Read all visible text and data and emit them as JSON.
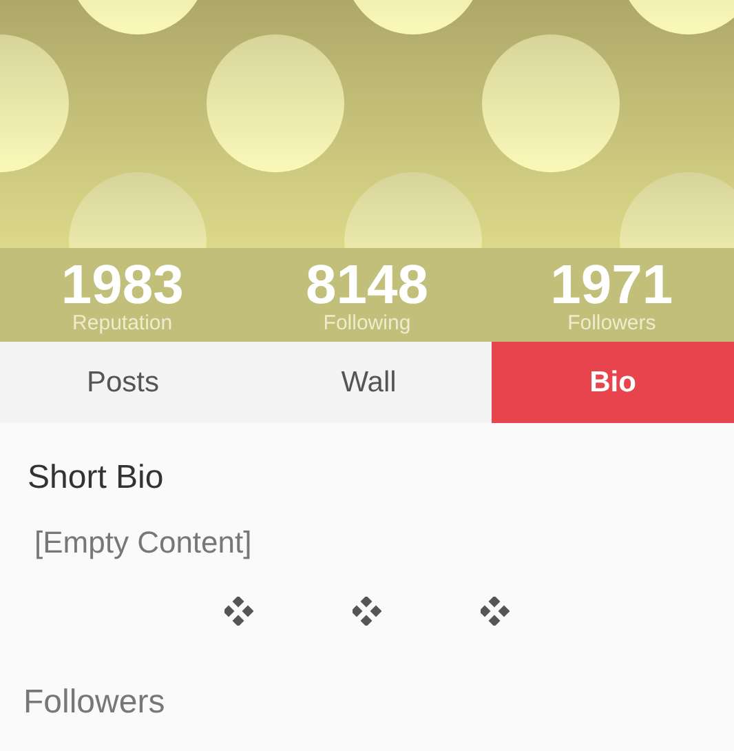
{
  "stats": [
    {
      "value": "1983",
      "label": "Reputation"
    },
    {
      "value": "8148",
      "label": "Following"
    },
    {
      "value": "1971",
      "label": "Followers"
    }
  ],
  "tabs": [
    {
      "label": "Posts",
      "selected": false
    },
    {
      "label": "Wall",
      "selected": false
    },
    {
      "label": "Bio",
      "selected": true
    }
  ],
  "bio": {
    "title": "Short Bio",
    "content": "[Empty Content]"
  },
  "separators": [
    {
      "kind": "diamonds"
    },
    {
      "kind": "diamonds"
    },
    {
      "kind": "diamonds"
    }
  ],
  "next_section": {
    "title": "Followers"
  }
}
